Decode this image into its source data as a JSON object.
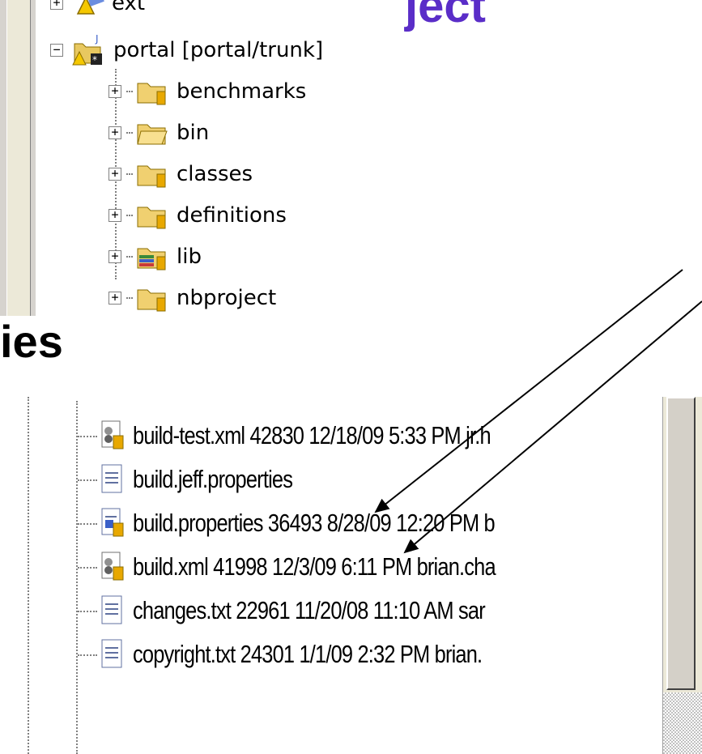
{
  "slide": {
    "title_fragment": "ject",
    "side_text": "ies"
  },
  "project_tree": {
    "clipped_item_label": "ext",
    "project": {
      "label": "portal [portal/trunk]",
      "expanded": true
    },
    "children": [
      {
        "label": "benchmarks",
        "icon": "package-folder-icon"
      },
      {
        "label": "bin",
        "icon": "folder-icon"
      },
      {
        "label": "classes",
        "icon": "package-folder-icon"
      },
      {
        "label": "definitions",
        "icon": "package-folder-icon"
      },
      {
        "label": "lib",
        "icon": "library-folder-icon"
      },
      {
        "label": "nbproject",
        "icon": "package-folder-icon"
      }
    ]
  },
  "file_list": {
    "rows": [
      {
        "text": "build-test.xml 42830  12/18/09 5:33 PM  jr.h",
        "icon": "xml-file-icon"
      },
      {
        "text": "build.jeff.properties",
        "icon": "text-file-icon"
      },
      {
        "text": "build.properties 36493  8/28/09 12:20 PM  b",
        "icon": "properties-file-icon"
      },
      {
        "text": "build.xml 41998  12/3/09 6:11 PM  brian.cha",
        "icon": "xml-file-icon"
      },
      {
        "text": "changes.txt 22961  11/20/08 11:10 AM  sar",
        "icon": "text-file-icon"
      },
      {
        "text": "copyright.txt 24301  1/1/09 2:32 PM  brian.",
        "icon": "text-file-icon"
      }
    ]
  },
  "colors": {
    "title": "#5a2dc8",
    "folder": "#e8c860",
    "scrollbar": "#d4d0c8"
  }
}
